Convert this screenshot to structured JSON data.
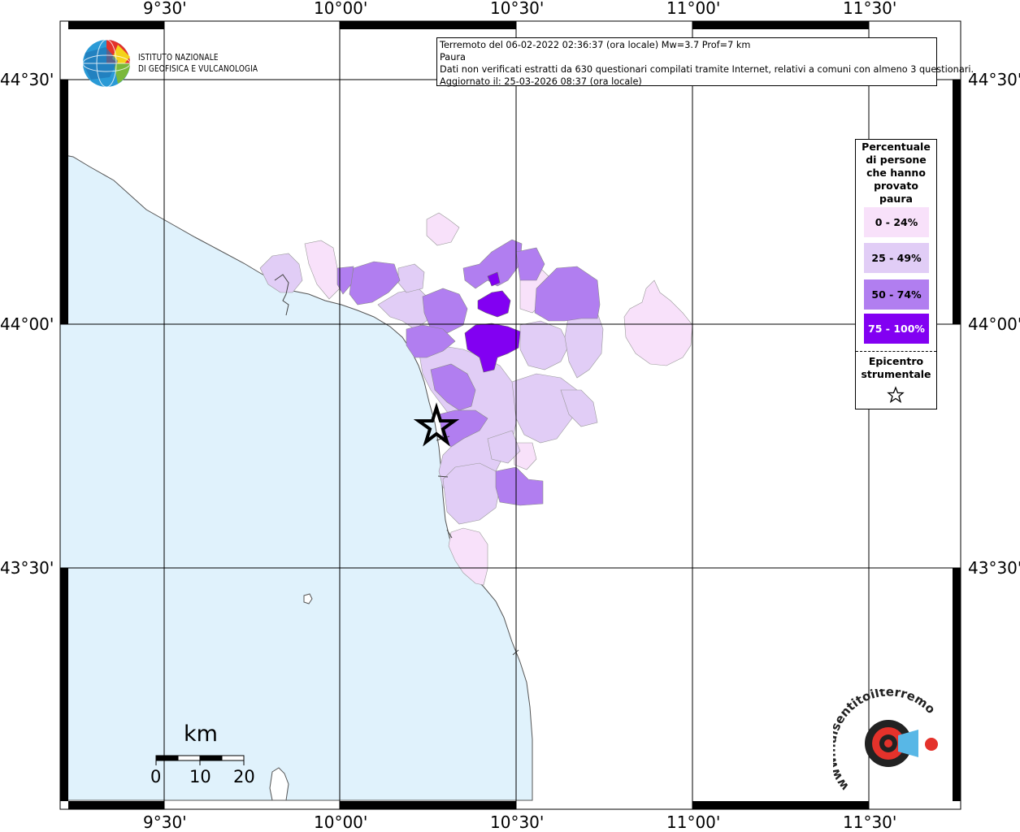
{
  "info": {
    "line1": "Terremoto del 06-02-2022 02:36:37 (ora locale) Mw=3.7 Prof=7 km",
    "line2": "Paura",
    "line3": "Dati non verificati estratti da 630 questionari compilati tramite Internet, relativi a comuni con almeno 3 questionari.",
    "line4": "Aggiornato il: 25-03-2026 08:37 (ora locale)"
  },
  "logo": {
    "line1": "ISTITUTO NAZIONALE",
    "line2": "DI GEOFISICA E VULCANOLOGIA"
  },
  "axes": {
    "top": [
      "9°30'",
      "10°00'",
      "10°30'",
      "11°00'",
      "11°30'"
    ],
    "bottom": [
      "9°30'",
      "10°00'",
      "10°30'",
      "11°00'",
      "11°30'"
    ],
    "left": [
      "44°30'",
      "44°00'",
      "43°30'"
    ],
    "right": [
      "44°30'",
      "44°00'",
      "43°30'"
    ]
  },
  "legend": {
    "title": "Percentuale di persone che hanno provato paura",
    "items": [
      {
        "label": "0 - 24%",
        "color": "#f8e1fa"
      },
      {
        "label": "25 - 49%",
        "color": "#e1cdf6"
      },
      {
        "label": "50 - 74%",
        "color": "#b17ef0"
      },
      {
        "label": "75 - 100%",
        "color": "#8200f2"
      }
    ],
    "epicenter_label": "Epicentro strumentale"
  },
  "scale": {
    "unit": "km",
    "ticks": [
      "0",
      "10",
      "20"
    ]
  },
  "watermark": "www.haisentitoilterremoto.it",
  "colors": {
    "sea": "#e0f2fc",
    "land": "#ffffff",
    "grid": "#000000"
  }
}
